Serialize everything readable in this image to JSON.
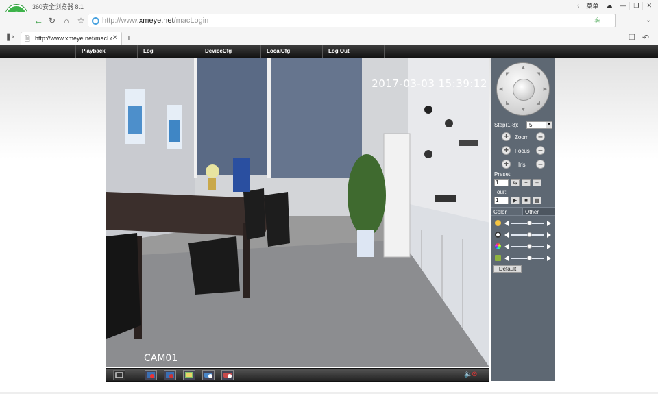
{
  "browser": {
    "app_title": "360安全浏览器 8.1",
    "logo_letter": "e",
    "menu_label": "菜单",
    "address_prefix": "http://www.",
    "address_domain": "xmeye.net",
    "address_path": "/macLogin",
    "tab_title": "http://www.xmeye.net/macLogin"
  },
  "webnav": {
    "items": [
      "Playback",
      "Log",
      "DeviceCfg",
      "LocalCfg",
      "Log Out"
    ]
  },
  "video": {
    "timestamp": "2017-03-03 15:39:12",
    "camera_label": "CAM01"
  },
  "ptz": {
    "step_label": "Step(1-8):",
    "step_value": "5",
    "zoom_label": "Zoom",
    "focus_label": "Focus",
    "iris_label": "Iris",
    "preset_label": "Preset:",
    "preset_value": "1",
    "tour_label": "Tour:",
    "tour_value": "1"
  },
  "image_tabs": {
    "color": "Color",
    "other": "Other"
  },
  "image_sliders": [
    {
      "name": "brightness",
      "level": 0.6,
      "icon_color": "#f5c542"
    },
    {
      "name": "contrast",
      "level": 0.6,
      "icon_color": "#ffffff"
    },
    {
      "name": "saturation",
      "level": 0.6,
      "icon_color": "#e96ee6"
    },
    {
      "name": "hue",
      "level": 0.6,
      "icon_color": "#8fb33f"
    }
  ],
  "default_button": "Default"
}
